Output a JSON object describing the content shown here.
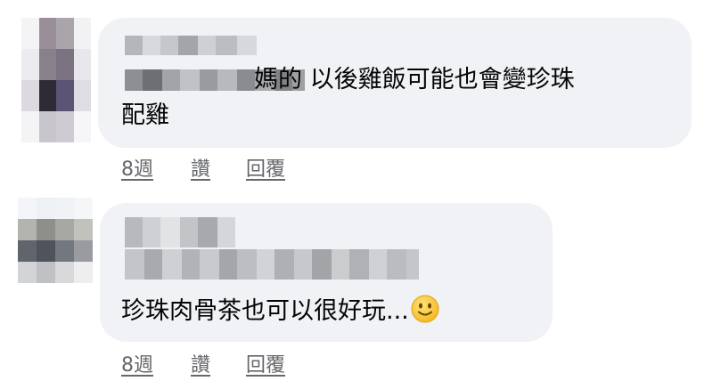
{
  "comments": [
    {
      "text_line1": "媽的 以後雞飯可能也會變珍珠",
      "text_line2": "配雞",
      "time": "8週",
      "like_label": "讚",
      "reply_label": "回覆"
    },
    {
      "text": "珍珠肉骨茶也可以很好玩...",
      "emoji": "slightly-smiling-face-icon",
      "time": "8週",
      "like_label": "讚",
      "reply_label": "回覆"
    }
  ],
  "colors": {
    "bubble_bg": "#f0f2f5",
    "text": "#050505",
    "secondary_text": "#65676b",
    "emoji_fill": "#ffcc4d"
  }
}
